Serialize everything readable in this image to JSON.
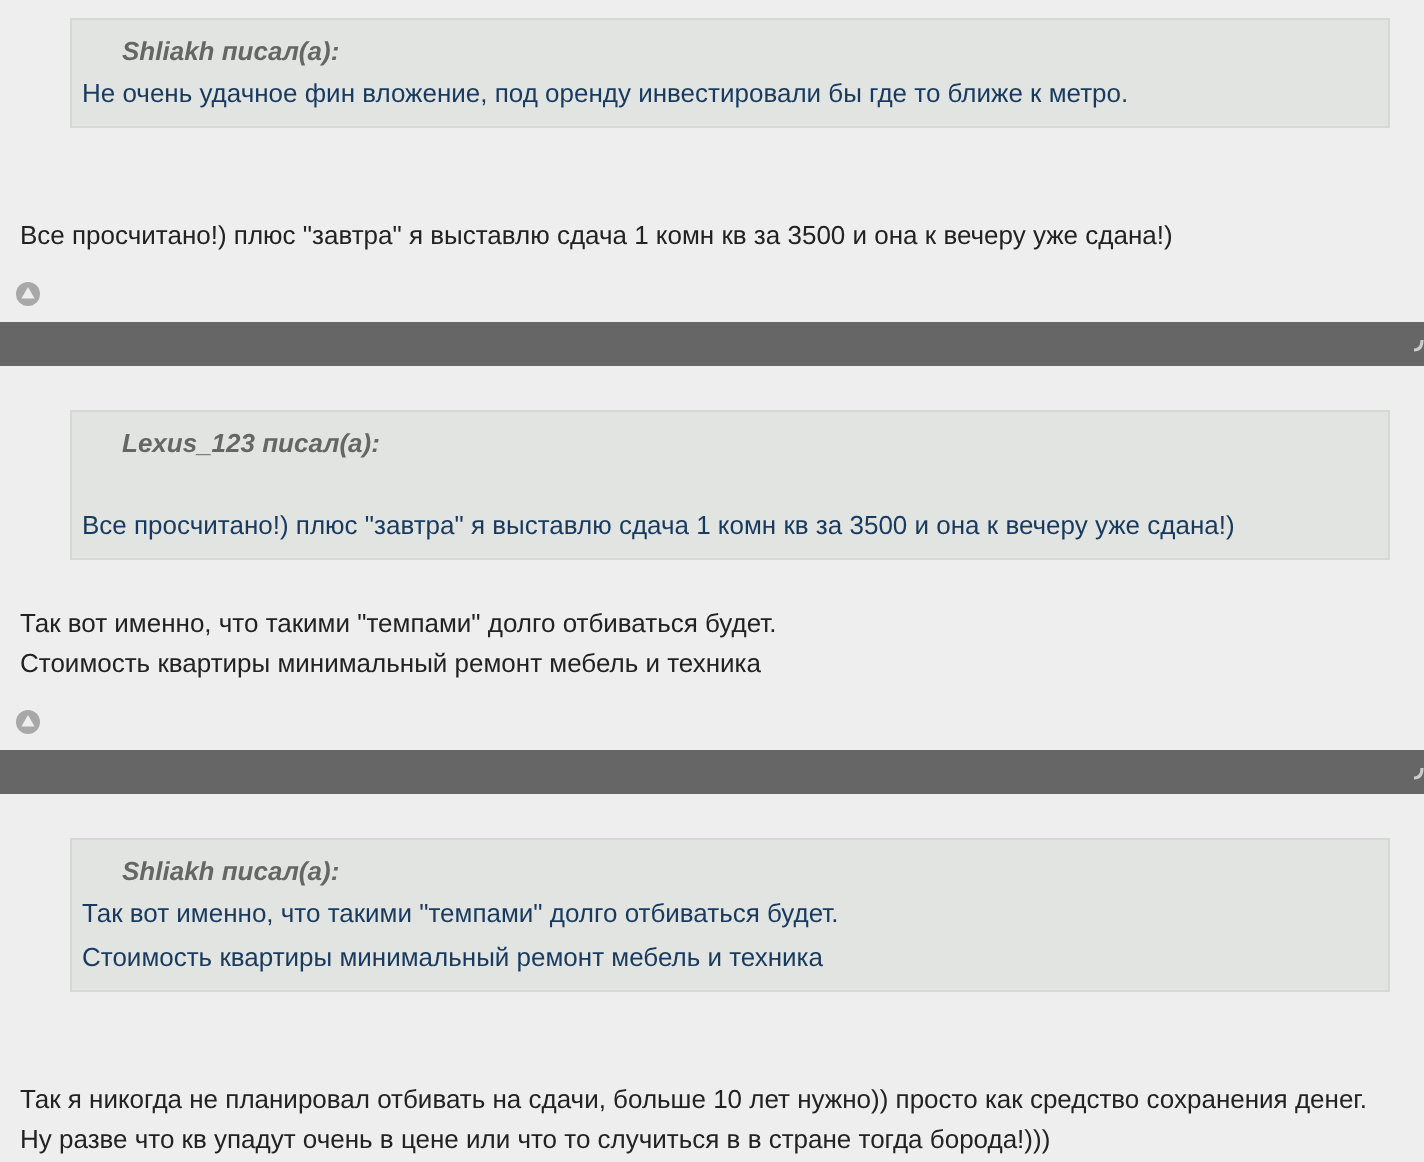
{
  "posts": [
    {
      "quote": {
        "author": "Shliakh писал(а):",
        "blank_after_author": false,
        "lines": [
          "Не очень удачное фин вложение, под оренду инвестировали бы где то ближе к метро."
        ]
      },
      "body": [
        "Все просчитано!) плюс \"завтра\" я выставлю сдача 1 комн кв за 3500 и она к вечеру уже сдана!)"
      ],
      "top_link": true,
      "separator": true
    },
    {
      "quote": {
        "author": "Lexus_123 писал(а):",
        "blank_after_author": true,
        "lines": [
          "Все просчитано!) плюс \"завтра\" я выставлю сдача 1 комн кв за 3500 и она к вечеру уже сдана!)"
        ]
      },
      "body": [
        "Так вот именно, что такими \"темпами\" долго отбиваться будет.",
        "Стоимость квартиры минимальный ремонт мебель и техника"
      ],
      "top_link": true,
      "separator": true
    },
    {
      "quote": {
        "author": "Shliakh писал(а):",
        "blank_after_author": false,
        "lines": [
          "Так вот именно, что такими \"темпами\" долго отбиваться будет.",
          "Стоимость квартиры минимальный ремонт мебель и техника"
        ]
      },
      "body": [
        "Так я никогда не планировал отбивать на сдачи, больше 10 лет нужно)) просто как средство сохранения денег. Ну разве что кв упадут очень в цене или что то случиться в в стране тогда борода!)))"
      ]
    }
  ]
}
